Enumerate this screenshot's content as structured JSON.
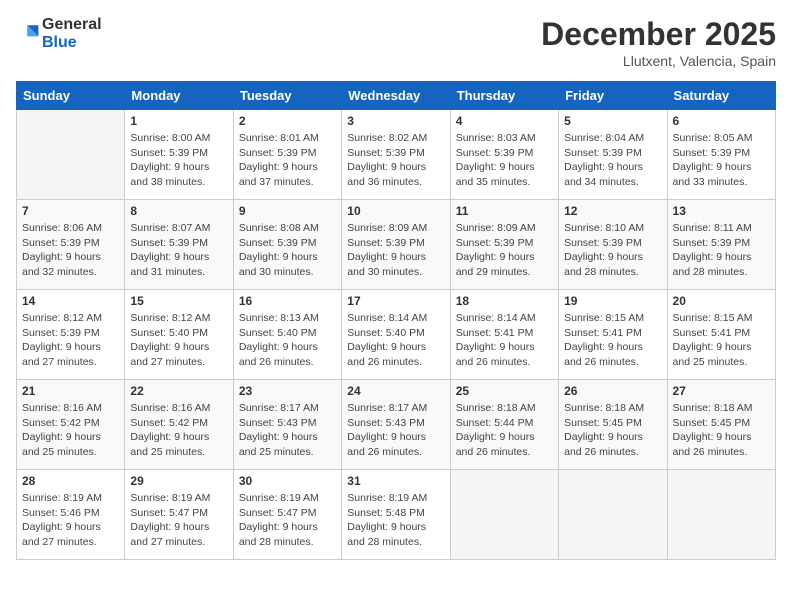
{
  "header": {
    "logo_line1": "General",
    "logo_line2": "Blue",
    "month": "December 2025",
    "location": "Llutxent, Valencia, Spain"
  },
  "weekdays": [
    "Sunday",
    "Monday",
    "Tuesday",
    "Wednesday",
    "Thursday",
    "Friday",
    "Saturday"
  ],
  "weeks": [
    [
      {
        "day": "",
        "info": ""
      },
      {
        "day": "1",
        "info": "Sunrise: 8:00 AM\nSunset: 5:39 PM\nDaylight: 9 hours\nand 38 minutes."
      },
      {
        "day": "2",
        "info": "Sunrise: 8:01 AM\nSunset: 5:39 PM\nDaylight: 9 hours\nand 37 minutes."
      },
      {
        "day": "3",
        "info": "Sunrise: 8:02 AM\nSunset: 5:39 PM\nDaylight: 9 hours\nand 36 minutes."
      },
      {
        "day": "4",
        "info": "Sunrise: 8:03 AM\nSunset: 5:39 PM\nDaylight: 9 hours\nand 35 minutes."
      },
      {
        "day": "5",
        "info": "Sunrise: 8:04 AM\nSunset: 5:39 PM\nDaylight: 9 hours\nand 34 minutes."
      },
      {
        "day": "6",
        "info": "Sunrise: 8:05 AM\nSunset: 5:39 PM\nDaylight: 9 hours\nand 33 minutes."
      }
    ],
    [
      {
        "day": "7",
        "info": "Sunrise: 8:06 AM\nSunset: 5:39 PM\nDaylight: 9 hours\nand 32 minutes."
      },
      {
        "day": "8",
        "info": "Sunrise: 8:07 AM\nSunset: 5:39 PM\nDaylight: 9 hours\nand 31 minutes."
      },
      {
        "day": "9",
        "info": "Sunrise: 8:08 AM\nSunset: 5:39 PM\nDaylight: 9 hours\nand 30 minutes."
      },
      {
        "day": "10",
        "info": "Sunrise: 8:09 AM\nSunset: 5:39 PM\nDaylight: 9 hours\nand 30 minutes."
      },
      {
        "day": "11",
        "info": "Sunrise: 8:09 AM\nSunset: 5:39 PM\nDaylight: 9 hours\nand 29 minutes."
      },
      {
        "day": "12",
        "info": "Sunrise: 8:10 AM\nSunset: 5:39 PM\nDaylight: 9 hours\nand 28 minutes."
      },
      {
        "day": "13",
        "info": "Sunrise: 8:11 AM\nSunset: 5:39 PM\nDaylight: 9 hours\nand 28 minutes."
      }
    ],
    [
      {
        "day": "14",
        "info": "Sunrise: 8:12 AM\nSunset: 5:39 PM\nDaylight: 9 hours\nand 27 minutes."
      },
      {
        "day": "15",
        "info": "Sunrise: 8:12 AM\nSunset: 5:40 PM\nDaylight: 9 hours\nand 27 minutes."
      },
      {
        "day": "16",
        "info": "Sunrise: 8:13 AM\nSunset: 5:40 PM\nDaylight: 9 hours\nand 26 minutes."
      },
      {
        "day": "17",
        "info": "Sunrise: 8:14 AM\nSunset: 5:40 PM\nDaylight: 9 hours\nand 26 minutes."
      },
      {
        "day": "18",
        "info": "Sunrise: 8:14 AM\nSunset: 5:41 PM\nDaylight: 9 hours\nand 26 minutes."
      },
      {
        "day": "19",
        "info": "Sunrise: 8:15 AM\nSunset: 5:41 PM\nDaylight: 9 hours\nand 26 minutes."
      },
      {
        "day": "20",
        "info": "Sunrise: 8:15 AM\nSunset: 5:41 PM\nDaylight: 9 hours\nand 25 minutes."
      }
    ],
    [
      {
        "day": "21",
        "info": "Sunrise: 8:16 AM\nSunset: 5:42 PM\nDaylight: 9 hours\nand 25 minutes."
      },
      {
        "day": "22",
        "info": "Sunrise: 8:16 AM\nSunset: 5:42 PM\nDaylight: 9 hours\nand 25 minutes."
      },
      {
        "day": "23",
        "info": "Sunrise: 8:17 AM\nSunset: 5:43 PM\nDaylight: 9 hours\nand 25 minutes."
      },
      {
        "day": "24",
        "info": "Sunrise: 8:17 AM\nSunset: 5:43 PM\nDaylight: 9 hours\nand 26 minutes."
      },
      {
        "day": "25",
        "info": "Sunrise: 8:18 AM\nSunset: 5:44 PM\nDaylight: 9 hours\nand 26 minutes."
      },
      {
        "day": "26",
        "info": "Sunrise: 8:18 AM\nSunset: 5:45 PM\nDaylight: 9 hours\nand 26 minutes."
      },
      {
        "day": "27",
        "info": "Sunrise: 8:18 AM\nSunset: 5:45 PM\nDaylight: 9 hours\nand 26 minutes."
      }
    ],
    [
      {
        "day": "28",
        "info": "Sunrise: 8:19 AM\nSunset: 5:46 PM\nDaylight: 9 hours\nand 27 minutes."
      },
      {
        "day": "29",
        "info": "Sunrise: 8:19 AM\nSunset: 5:47 PM\nDaylight: 9 hours\nand 27 minutes."
      },
      {
        "day": "30",
        "info": "Sunrise: 8:19 AM\nSunset: 5:47 PM\nDaylight: 9 hours\nand 28 minutes."
      },
      {
        "day": "31",
        "info": "Sunrise: 8:19 AM\nSunset: 5:48 PM\nDaylight: 9 hours\nand 28 minutes."
      },
      {
        "day": "",
        "info": ""
      },
      {
        "day": "",
        "info": ""
      },
      {
        "day": "",
        "info": ""
      }
    ]
  ]
}
